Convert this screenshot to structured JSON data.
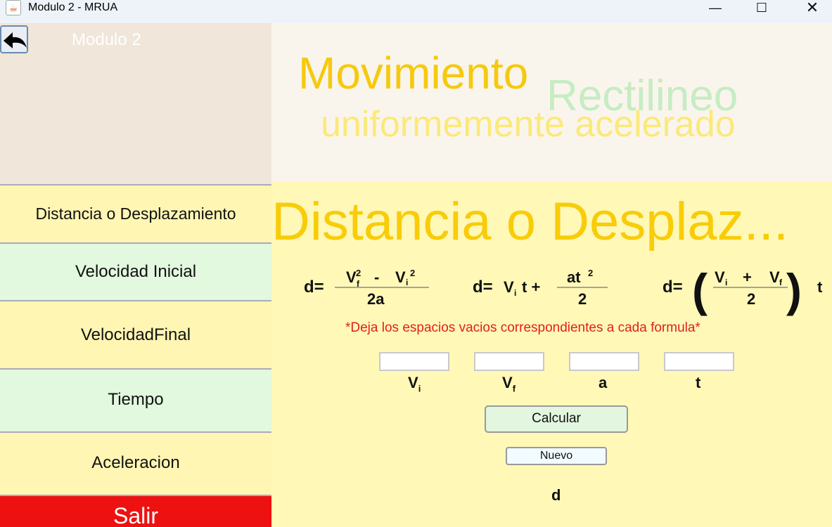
{
  "window": {
    "title": "Modulo 2 - MRUA",
    "minimize": "—",
    "maximize": "☐",
    "close": "✕"
  },
  "sidebar": {
    "module_label": "Modulo 2",
    "items": [
      {
        "label": "Distancia o Desplazamiento"
      },
      {
        "label": "Velocidad Inicial"
      },
      {
        "label": "VelocidadFinal"
      },
      {
        "label": "Tiempo"
      },
      {
        "label": "Aceleracion"
      }
    ],
    "exit_label": "Salir"
  },
  "header": {
    "word1": "Movimiento",
    "word2": "Rectilineo",
    "word3": "uniformemente acelerado"
  },
  "main": {
    "title": "Distancia o Desplaz...",
    "hint": "*Deja los espacios vacios correspondientes a cada formula*",
    "inputs": {
      "vi": {
        "value": "",
        "label": "V",
        "sub": "i"
      },
      "vf": {
        "value": "",
        "label": "V",
        "sub": "f"
      },
      "a": {
        "value": "",
        "label": "a"
      },
      "t": {
        "value": "",
        "label": "t"
      }
    },
    "calc_label": "Calcular",
    "new_label": "Nuevo",
    "result_label": "d"
  },
  "formulas": {
    "f1": {
      "lhs": "d=",
      "num": "V²f - Vi²",
      "den": "2a"
    },
    "f2": {
      "lhs": "d=",
      "term": "Vi t +",
      "num": "at²",
      "den": "2"
    },
    "f3": {
      "lhs": "d=",
      "num": "Vi + Vf",
      "den": "2",
      "tail": "t"
    }
  },
  "colors": {
    "title_yellow": "#f8cc08",
    "exit_red": "#ee1111",
    "hint_red": "#e02020",
    "panel_yellow": "#fff8b7",
    "panel_green": "#e2f8df"
  }
}
